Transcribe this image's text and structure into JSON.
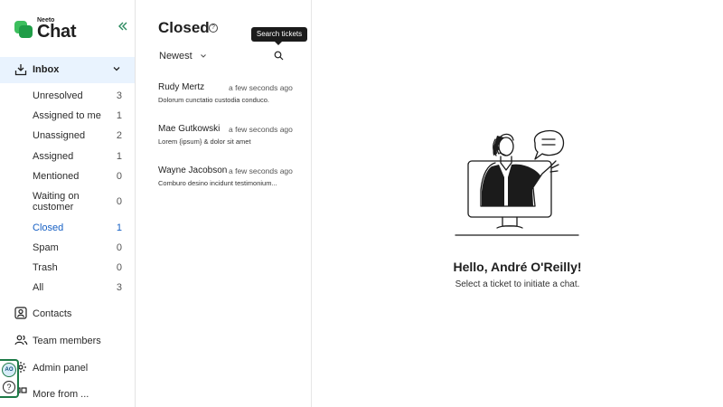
{
  "brand": {
    "small": "Neeto",
    "big": "Chat",
    "accent": "#1f9d47"
  },
  "sidebar": {
    "inbox_label": "Inbox",
    "inbox_items": [
      {
        "label": "Unresolved",
        "count": "3"
      },
      {
        "label": "Assigned to me",
        "count": "1"
      },
      {
        "label": "Unassigned",
        "count": "2"
      },
      {
        "label": "Assigned",
        "count": "1"
      },
      {
        "label": "Mentioned",
        "count": "0"
      },
      {
        "label": "Waiting on customer",
        "count": "0"
      },
      {
        "label": "Closed",
        "count": "1"
      },
      {
        "label": "Spam",
        "count": "0"
      },
      {
        "label": "Trash",
        "count": "0"
      },
      {
        "label": "All",
        "count": "3"
      }
    ],
    "nav": [
      {
        "label": "Contacts",
        "icon": "contacts-icon"
      },
      {
        "label": "Team members",
        "icon": "team-icon"
      },
      {
        "label": "Admin panel",
        "icon": "settings-icon"
      },
      {
        "label": "More from ...",
        "icon": "grid-icon"
      }
    ],
    "avatar_initials": "AO",
    "active_color": "#1760c4"
  },
  "list": {
    "title": "Closed",
    "sort_label": "Newest",
    "search_tooltip": "Search tickets",
    "tickets": [
      {
        "name": "Rudy Mertz",
        "time": "a few seconds ago",
        "preview": "Dolorum cunctatio custodia conduco."
      },
      {
        "name": "Mae Gutkowski",
        "time": "a few seconds ago",
        "preview": "Lorem {ipsum} & dolor sit amet"
      },
      {
        "name": "Wayne Jacobson",
        "time": "a few seconds ago",
        "preview": "Comburo desino incidunt testimonium..."
      }
    ]
  },
  "main": {
    "greeting": "Hello, André O'Reilly!",
    "subtext": "Select a ticket to initiate a chat."
  }
}
